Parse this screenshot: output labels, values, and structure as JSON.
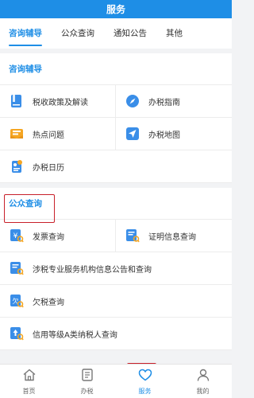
{
  "header": {
    "title": "服务"
  },
  "tabs": [
    {
      "label": "咨询辅导",
      "active": true
    },
    {
      "label": "公众查询",
      "active": false
    },
    {
      "label": "通知公告",
      "active": false
    },
    {
      "label": "其他",
      "active": false
    }
  ],
  "sections": {
    "consult": {
      "title": "咨询辅导",
      "items": [
        {
          "label": "税收政策及解读",
          "icon": "book-icon"
        },
        {
          "label": "办税指南",
          "icon": "compass-icon"
        },
        {
          "label": "热点问题",
          "icon": "mail-icon"
        },
        {
          "label": "办税地图",
          "icon": "paper-plane-icon"
        },
        {
          "label": "办税日历",
          "icon": "calendar-doc-icon"
        }
      ]
    },
    "public": {
      "title": "公众查询",
      "items": [
        {
          "label": "发票查询",
          "icon": "invoice-search-icon"
        },
        {
          "label": "证明信息查询",
          "icon": "certificate-search-icon"
        },
        {
          "label": "涉税专业服务机构信息公告和查询",
          "icon": "agency-search-icon"
        },
        {
          "label": "欠税查询",
          "icon": "arrears-search-icon"
        },
        {
          "label": "信用等级A类纳税人查询",
          "icon": "credit-search-icon"
        }
      ]
    }
  },
  "tabbar": [
    {
      "label": "首页",
      "icon": "home-icon",
      "active": false
    },
    {
      "label": "办税",
      "icon": "list-icon",
      "active": false
    },
    {
      "label": "服务",
      "icon": "heart-icon",
      "active": true
    },
    {
      "label": "我的",
      "icon": "user-icon",
      "active": false
    }
  ],
  "colors": {
    "brand": "#1e8ee6",
    "highlight": "#c8202a",
    "orange": "#f5a623"
  }
}
